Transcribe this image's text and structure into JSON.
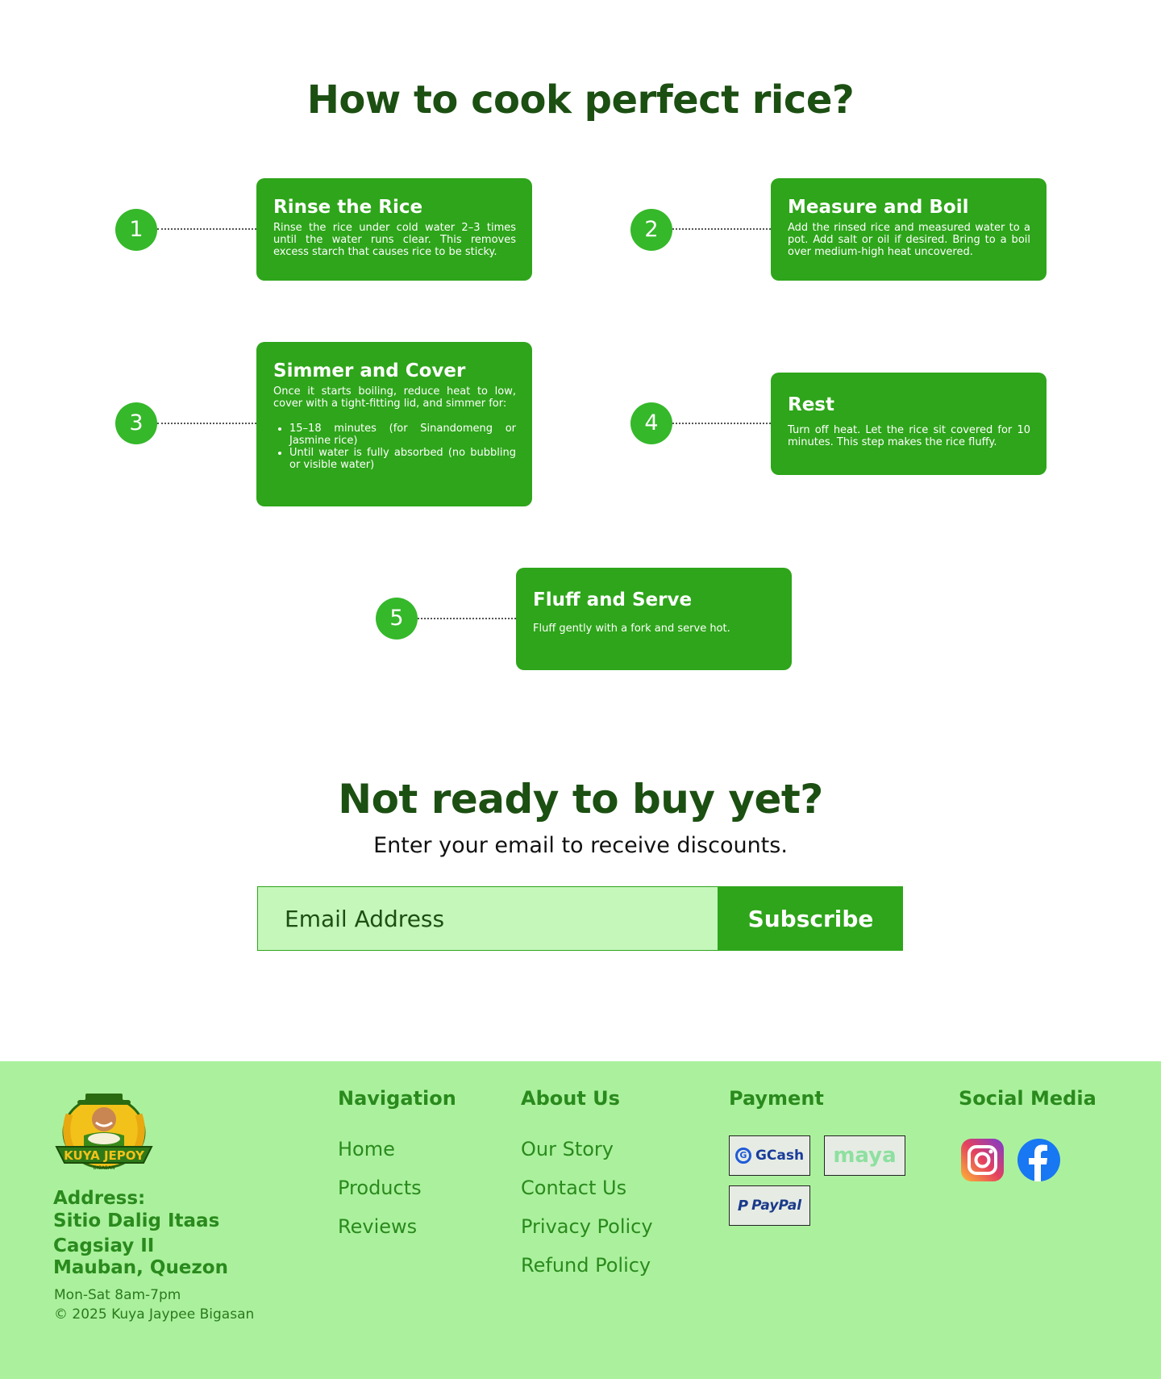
{
  "how_to": {
    "title": "How to cook perfect rice?",
    "steps": [
      {
        "number": "1",
        "title": "Rinse the Rice",
        "text": "Rinse the rice under cold water 2–3 times until the water runs clear. This removes excess starch that causes rice to be sticky."
      },
      {
        "number": "2",
        "title": "Measure and Boil",
        "text": "Add the rinsed rice and measured water to a pot. Add salt or oil if desired. Bring to a boil over medium-high heat uncovered."
      },
      {
        "number": "3",
        "title": "Simmer and Cover",
        "text": "Once it starts boiling, reduce heat to low, cover with a tight-fitting lid, and simmer for:",
        "bullets": [
          "15–18 minutes (for Sinandomeng or Jasmine rice)",
          "Until water is fully absorbed (no bubbling or visible water)"
        ]
      },
      {
        "number": "4",
        "title": "Rest",
        "text": "Turn off heat. Let the rice sit covered for 10 minutes. This step makes the rice fluffy."
      },
      {
        "number": "5",
        "title": "Fluff and Serve",
        "text": "Fluff gently with a fork and serve hot."
      }
    ]
  },
  "newsletter": {
    "title": "Not ready to buy yet?",
    "subtitle": "Enter your email to receive discounts.",
    "email_placeholder": "Email Address",
    "button_label": "Subscribe"
  },
  "footer": {
    "logo_text": "KUYA JEPOY",
    "logo_subtext": "BIGASAN",
    "address_label": "Address:",
    "address_lines": [
      "Sitio Dalig Itaas",
      "Cagsiay II",
      "Mauban, Quezon"
    ],
    "hours": "Mon-Sat 8am-7pm",
    "copyright": "© 2025 Kuya Jaypee Bigasan",
    "navigation": {
      "title": "Navigation",
      "links": [
        "Home",
        "Products",
        "Reviews"
      ]
    },
    "about": {
      "title": "About Us",
      "links": [
        "Our Story",
        "Contact Us",
        "Privacy Policy",
        "Refund Policy"
      ]
    },
    "payment": {
      "title": "Payment",
      "methods": [
        "GCash",
        "maya",
        "PayPal"
      ]
    },
    "social": {
      "title": "Social Media",
      "icons": [
        "instagram-icon",
        "facebook-icon"
      ]
    }
  },
  "colors": {
    "primary_green": "#2ea51a",
    "dark_green": "#1c4f12",
    "step_circle": "#35b82a",
    "footer_bg": "#abf19d",
    "input_bg": "#c5f7bb"
  }
}
